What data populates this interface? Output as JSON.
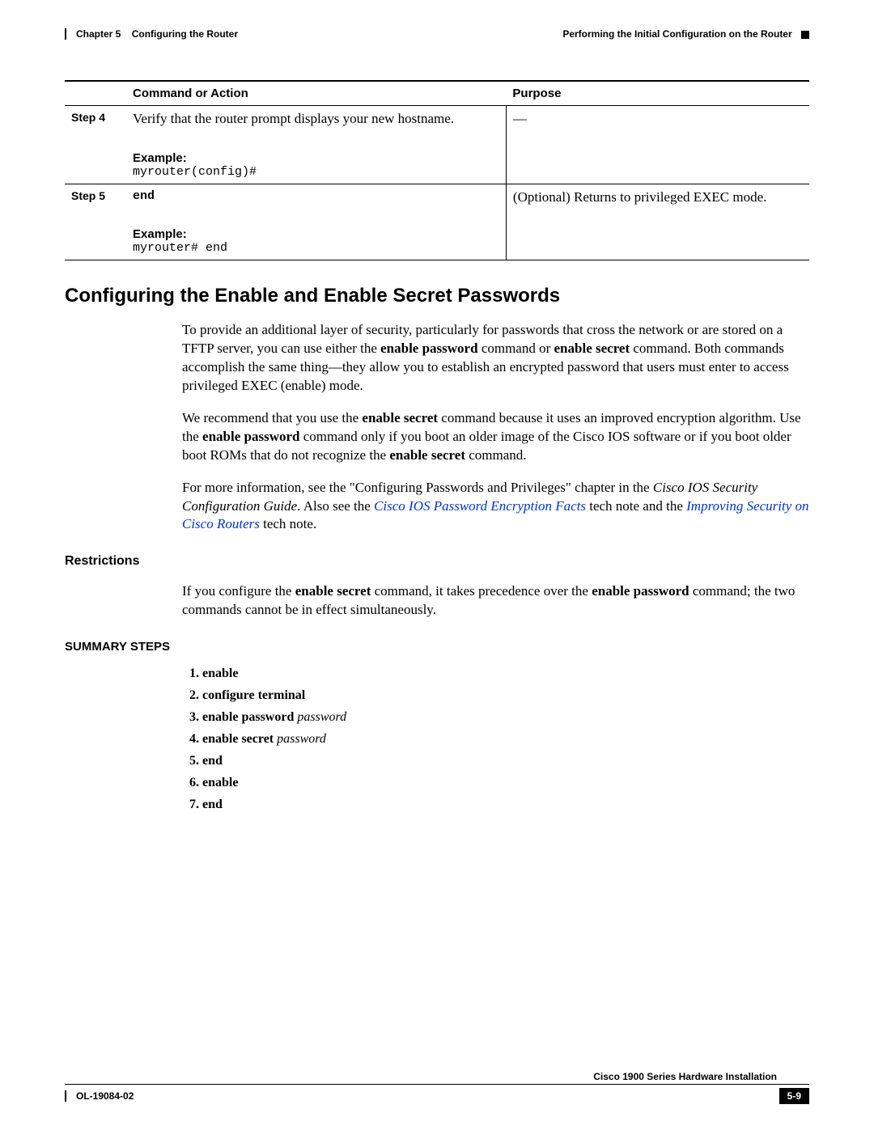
{
  "header": {
    "chapter_label": "Chapter 5",
    "chapter_title": "Configuring the Router",
    "section_right": "Performing the Initial Configuration on the Router"
  },
  "table": {
    "col1_header": "Command or Action",
    "col2_header": "Purpose",
    "step4": {
      "step_label": "Step 4",
      "action": "Verify that the router prompt displays your new hostname.",
      "example_label": "Example:",
      "example_code": "myrouter(config)#",
      "purpose": "—"
    },
    "step5": {
      "step_label": "Step 5",
      "action_cmd": "end",
      "example_label": "Example:",
      "example_code": "myrouter# end",
      "purpose": "(Optional) Returns to privileged EXEC mode."
    }
  },
  "section_title": "Configuring the Enable and Enable Secret Passwords",
  "para1_pre": "To provide an additional layer of security, particularly for passwords that cross the network or are stored on a TFTP server, you can use either the ",
  "para1_b1": "enable password",
  "para1_mid1": " command or ",
  "para1_b2": "enable secret",
  "para1_post": " command. Both commands accomplish the same thing—they allow you to establish an encrypted password that users must enter to access privileged EXEC (enable) mode.",
  "para2_pre": "We recommend that you use the ",
  "para2_b1": "enable secret",
  "para2_mid1": " command because it uses an improved encryption algorithm. Use the ",
  "para2_b2": "enable password",
  "para2_mid2": " command only if you boot an older image of the Cisco IOS software or if you boot older boot ROMs that do not recognize the ",
  "para2_b3": "enable secret",
  "para2_post": " command.",
  "para3_pre": "For more information, see the \"Configuring Passwords and Privileges\" chapter in the ",
  "para3_i1": "Cisco IOS Security Configuration Guide",
  "para3_mid1": ". Also see the ",
  "para3_link1": "Cisco IOS Password Encryption Facts",
  "para3_mid2": " tech note and the ",
  "para3_link2": "Improving Security on Cisco Routers",
  "para3_post": " tech note.",
  "restrictions_head": "Restrictions",
  "restrictions_p_pre": "If you configure the ",
  "restrictions_b1": "enable secret",
  "restrictions_mid": " command, it takes precedence over the ",
  "restrictions_b2": "enable password",
  "restrictions_post": " command; the two commands cannot be in effect simultaneously.",
  "summary_head": "SUMMARY STEPS",
  "summary": {
    "s1": "enable",
    "s2": "configure terminal",
    "s3a": "enable password ",
    "s3b": "password",
    "s4a": "enable secret ",
    "s4b": "password",
    "s5": "end",
    "s6": "enable",
    "s7": "end"
  },
  "footer": {
    "doc_title": "Cisco 1900 Series Hardware Installation",
    "doc_id": "OL-19084-02",
    "page_num": "5-9"
  }
}
